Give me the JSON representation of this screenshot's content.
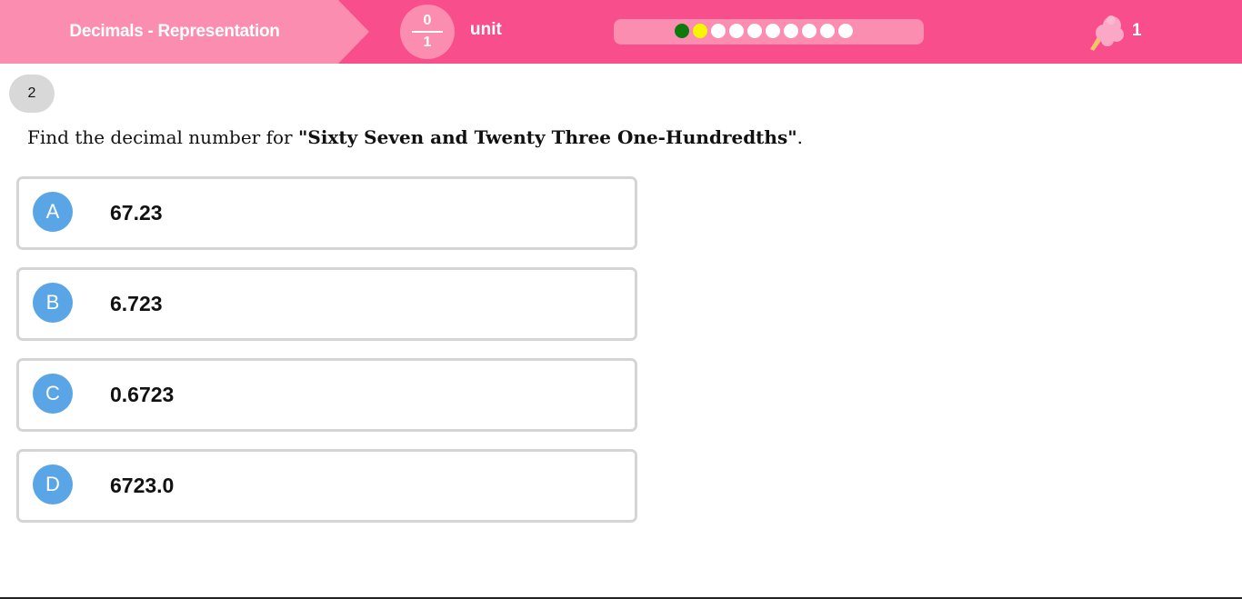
{
  "header": {
    "topic": "Decimals - Representation",
    "score": {
      "numerator": "0",
      "denominator": "1"
    },
    "unit_label": "unit",
    "progress": {
      "dots": [
        {
          "state": "correct",
          "color": "#0e7a0e"
        },
        {
          "state": "current",
          "color": "#f6f600"
        },
        {
          "state": "pending",
          "color": "#ffffff"
        },
        {
          "state": "pending",
          "color": "#ffffff"
        },
        {
          "state": "pending",
          "color": "#ffffff"
        },
        {
          "state": "pending",
          "color": "#ffffff"
        },
        {
          "state": "pending",
          "color": "#ffffff"
        },
        {
          "state": "pending",
          "color": "#ffffff"
        },
        {
          "state": "pending",
          "color": "#ffffff"
        },
        {
          "state": "pending",
          "color": "#ffffff"
        }
      ]
    },
    "reward": {
      "icon": "cotton-candy-icon",
      "count": "1"
    },
    "colors": {
      "bar": "#f84e8c",
      "accent": "#fb8db0"
    }
  },
  "question": {
    "number": "2",
    "prefix": "Find the decimal number for ",
    "phrase": "\"Sixty Seven and Twenty Three One-Hundredths\"",
    "suffix": "."
  },
  "options": [
    {
      "letter": "A",
      "value": "67.23"
    },
    {
      "letter": "B",
      "value": "6.723"
    },
    {
      "letter": "C",
      "value": "0.6723"
    },
    {
      "letter": "D",
      "value": "6723.0"
    }
  ],
  "colors": {
    "option_badge": "#5aa5e6",
    "option_border": "#d5d5d5"
  }
}
